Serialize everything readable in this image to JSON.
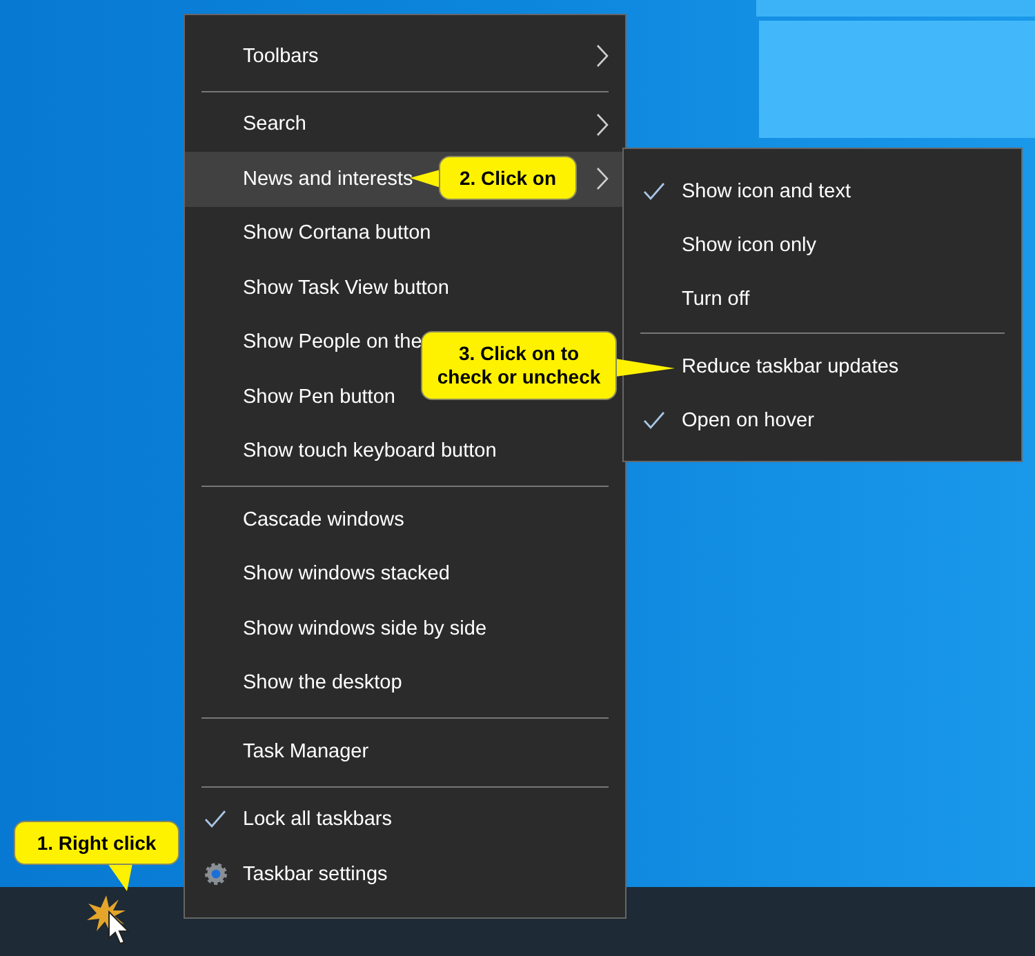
{
  "context_menu": {
    "items": [
      {
        "kind": "item",
        "label": "Toolbars",
        "has_submenu": true,
        "checked": false,
        "selected": false
      },
      {
        "kind": "separator"
      },
      {
        "kind": "item",
        "label": "Search",
        "has_submenu": true,
        "checked": false,
        "selected": false
      },
      {
        "kind": "item",
        "label": "News and interests",
        "has_submenu": true,
        "checked": false,
        "selected": true
      },
      {
        "kind": "item",
        "label": "Show Cortana button",
        "has_submenu": false,
        "checked": false,
        "selected": false
      },
      {
        "kind": "item",
        "label": "Show Task View button",
        "has_submenu": false,
        "checked": false,
        "selected": false
      },
      {
        "kind": "item",
        "label": "Show People on the",
        "checked": false,
        "selected": false
      },
      {
        "kind": "item",
        "label": "Show Pen button",
        "has_submenu": false,
        "checked": false,
        "selected": false
      },
      {
        "kind": "item",
        "label": "Show touch keyboard button",
        "has_submenu": false,
        "checked": false,
        "selected": false
      },
      {
        "kind": "separator"
      },
      {
        "kind": "item",
        "label": "Cascade windows",
        "has_submenu": false,
        "checked": false,
        "selected": false
      },
      {
        "kind": "item",
        "label": "Show windows stacked",
        "has_submenu": false,
        "checked": false,
        "selected": false
      },
      {
        "kind": "item",
        "label": "Show windows side by side",
        "has_submenu": false,
        "checked": false,
        "selected": false
      },
      {
        "kind": "item",
        "label": "Show the desktop",
        "has_submenu": false,
        "checked": false,
        "selected": false
      },
      {
        "kind": "separator"
      },
      {
        "kind": "item",
        "label": "Task Manager",
        "has_submenu": false,
        "checked": false,
        "selected": false
      },
      {
        "kind": "separator"
      },
      {
        "kind": "item",
        "label": "Lock all taskbars",
        "has_submenu": false,
        "checked": true,
        "selected": false
      },
      {
        "kind": "settings",
        "label": "Taskbar settings",
        "has_submenu": false,
        "checked": false,
        "selected": false
      }
    ]
  },
  "submenu": {
    "items": [
      {
        "kind": "item",
        "label": "Show icon and text",
        "checked": true
      },
      {
        "kind": "item",
        "label": "Show icon only",
        "checked": false
      },
      {
        "kind": "item",
        "label": "Turn off",
        "checked": false
      },
      {
        "kind": "separator"
      },
      {
        "kind": "item",
        "label": "Reduce taskbar updates",
        "checked": false
      },
      {
        "kind": "item",
        "label": "Open on hover",
        "checked": true
      }
    ]
  },
  "callouts": [
    {
      "text": "1. Right click"
    },
    {
      "text": "2. Click on"
    },
    {
      "text": "3. Click on to check or uncheck"
    }
  ]
}
